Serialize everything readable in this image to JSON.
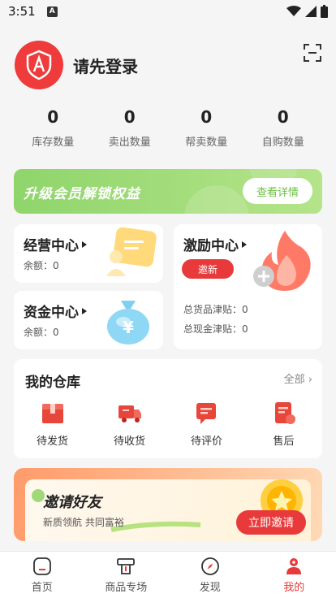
{
  "status_bar": {
    "time": "3:51",
    "notif_glyph": "A"
  },
  "header": {
    "login_text": "请先登录"
  },
  "stats": [
    {
      "value": "0",
      "label": "库存数量"
    },
    {
      "value": "0",
      "label": "卖出数量"
    },
    {
      "value": "0",
      "label": "帮卖数量"
    },
    {
      "value": "0",
      "label": "自购数量"
    }
  ],
  "upgrade_banner": {
    "title": "升级会员解锁权益",
    "button": "查看详情"
  },
  "business_center": {
    "title": "经营中心",
    "balance": "余额：0"
  },
  "fund_center": {
    "title": "资金中心",
    "balance": "余额：0"
  },
  "incentive_center": {
    "title": "激励中心",
    "invite_button": "邀新",
    "goods_subsidy": "总货品津贴：0",
    "cash_subsidy": "总现金津贴：0"
  },
  "warehouse": {
    "title": "我的仓库",
    "all_link": "全部",
    "items": [
      {
        "label": "待发货",
        "icon": "box-icon"
      },
      {
        "label": "待收货",
        "icon": "truck-icon"
      },
      {
        "label": "待评价",
        "icon": "comment-icon"
      },
      {
        "label": "售后",
        "icon": "aftersale-icon"
      }
    ]
  },
  "invite_banner": {
    "title": "邀请好友",
    "subtitle": "新质领航 共同富裕",
    "button": "立即邀请"
  },
  "tabbar": [
    {
      "label": "首页",
      "icon": "home-icon"
    },
    {
      "label": "商品专场",
      "icon": "product-icon"
    },
    {
      "label": "发现",
      "icon": "compass-icon"
    },
    {
      "label": "我的",
      "icon": "user-icon",
      "active": true
    }
  ],
  "colors": {
    "accent": "#e83a3a",
    "green": "#8fd56b",
    "background": "#f5f5f5"
  }
}
